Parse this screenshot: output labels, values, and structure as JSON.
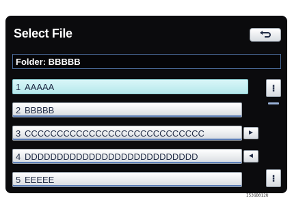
{
  "header": {
    "title": "Select File",
    "back_icon": "return-arrow-icon"
  },
  "folder": {
    "label": "Folder: BBBBB"
  },
  "files": [
    {
      "index": "1",
      "name": "AAAAA",
      "selected": true
    },
    {
      "index": "2",
      "name": "BBBBB"
    },
    {
      "index": "3",
      "name": "CCCCCCCCCCCCCCCCCCCCCCCCCCCC"
    },
    {
      "index": "4",
      "name": "DDDDDDDDDDDDDDDDDDDDDDDDDDD"
    },
    {
      "index": "5",
      "name": "EEEEE"
    }
  ],
  "row_buttons": {
    "scroll_right": "►",
    "scroll_left": "◄"
  },
  "scroll": {
    "up_icon": "scroll-up-icon",
    "down_icon": "scroll-down-icon",
    "up_label": "⁝",
    "down_label": "⁝"
  },
  "footer_code": "I53GB012U"
}
